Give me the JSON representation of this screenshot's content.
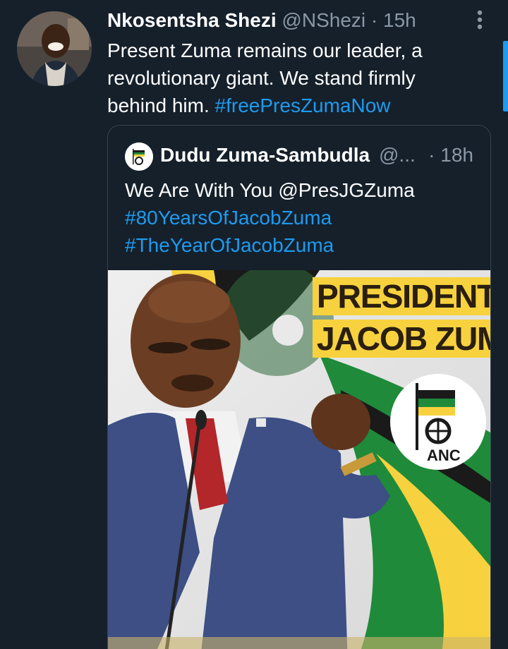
{
  "tweet": {
    "author": {
      "display_name": "Nkosentsha Shezi",
      "handle": "@NShezi"
    },
    "separator": "·",
    "time": "15h",
    "text_lines": [
      "Present Zuma remains our leader, a",
      "revolutionary giant. We stand firmly",
      "behind him. "
    ],
    "hashtag": "#freePresZumaNow"
  },
  "quoted_tweet": {
    "author": {
      "display_name": "Dudu Zuma-Sambudla",
      "handle": "@..."
    },
    "time": "· 18h",
    "text_lines": [
      "We Are With You @PresJGZuma",
      "#80YearsOfJacobZuma",
      "#TheYearOfJacobZuma"
    ],
    "media": {
      "title_lines": [
        "PRESIDENT",
        "JACOB ZUMA"
      ],
      "logo_text": "ANC"
    }
  },
  "colors": {
    "background": "#15202b",
    "text": "#ffffff",
    "muted": "#8b98a5",
    "accent": "#1d9bf0",
    "border": "#38444d",
    "anc_green": "#1f8a3a",
    "anc_gold": "#f7d23e"
  },
  "icons": {
    "more": "vertical-dots-icon"
  }
}
